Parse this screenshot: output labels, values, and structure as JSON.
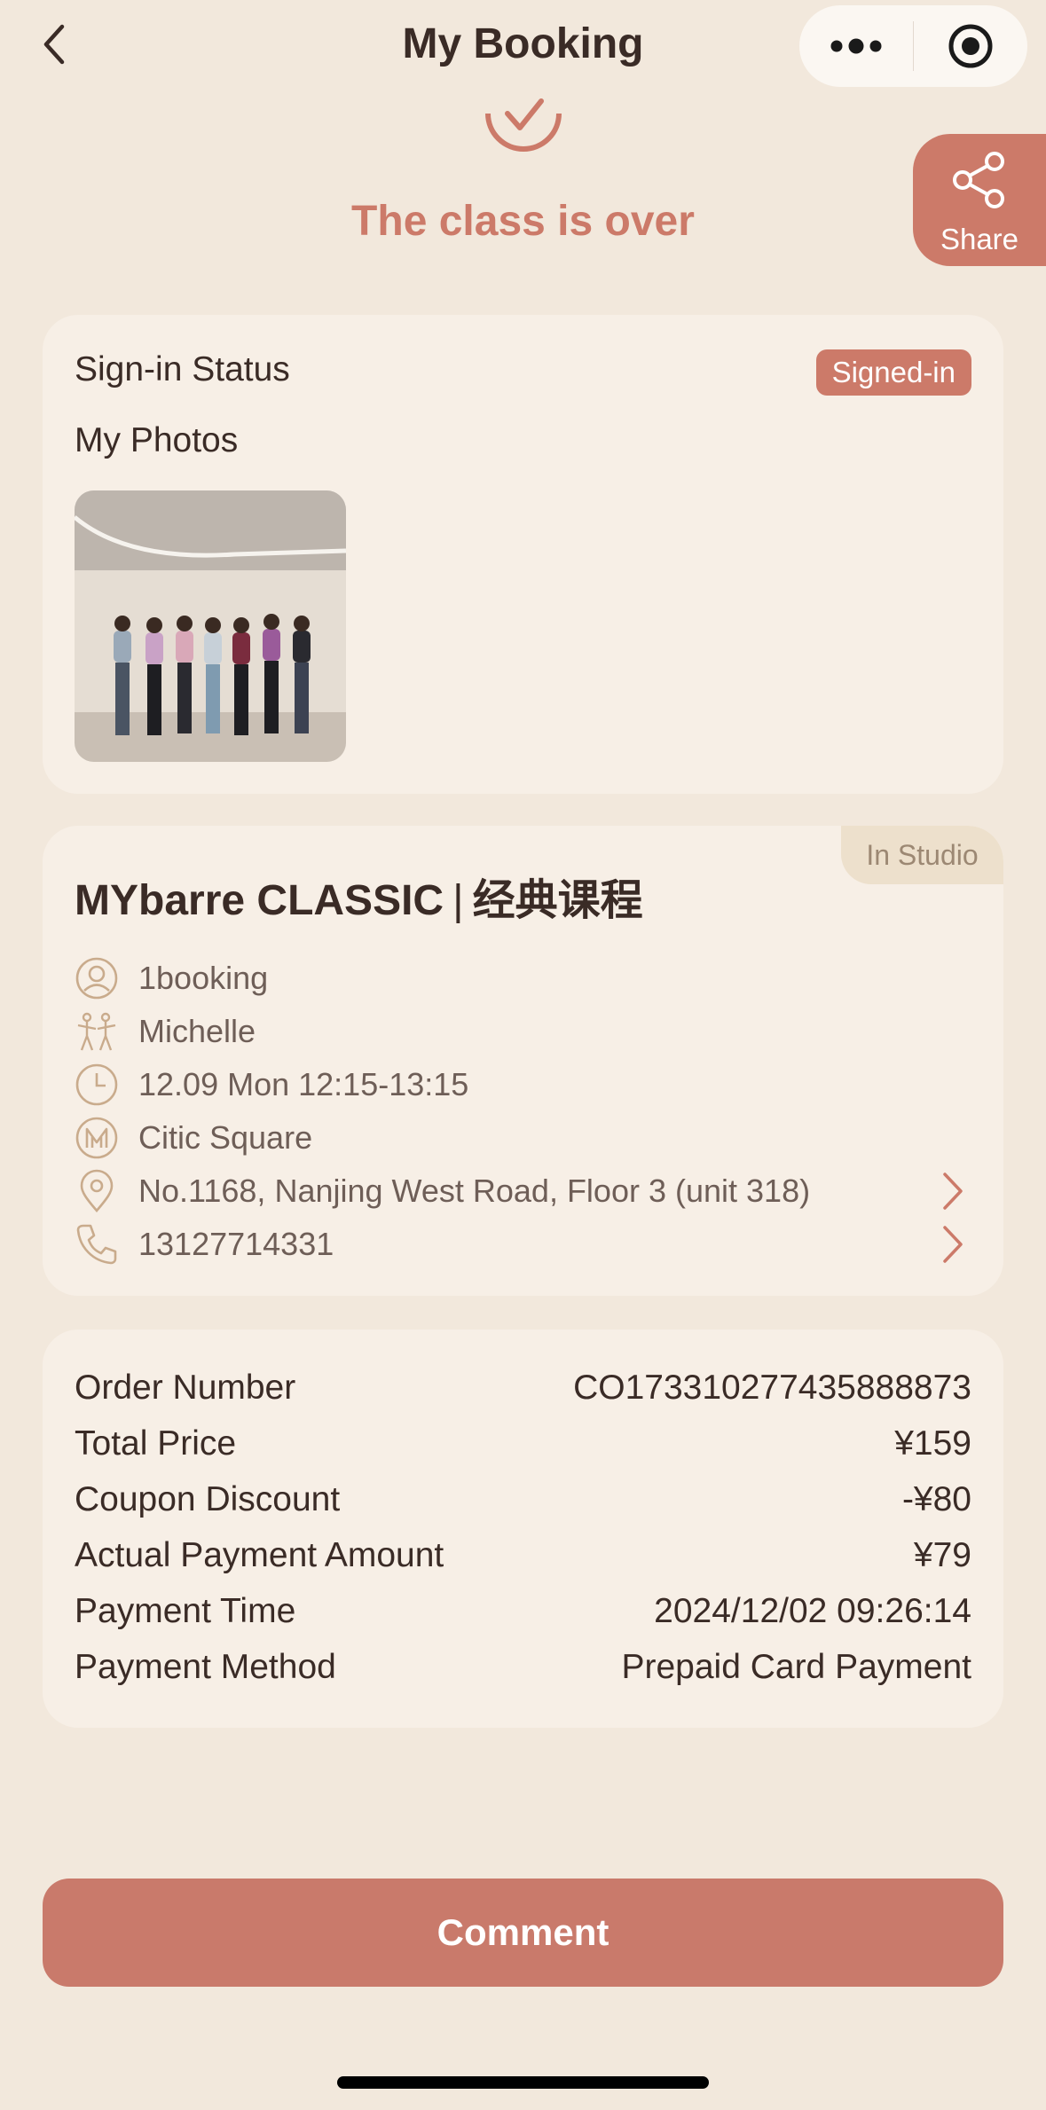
{
  "nav": {
    "title": "My Booking"
  },
  "status": {
    "text": "The class is over"
  },
  "share": {
    "label": "Share"
  },
  "signin": {
    "label": "Sign-in Status",
    "badge": "Signed-in",
    "photos_label": "My Photos"
  },
  "class_info": {
    "tag": "In Studio",
    "title_en": "MYbarre CLASSIC",
    "title_cn": "经典课程",
    "rows": [
      {
        "icon": "user-icon",
        "text": "1booking"
      },
      {
        "icon": "instructor-icon",
        "text": "Michelle"
      },
      {
        "icon": "clock-icon",
        "text": "12.09 Mon 12:15-13:15"
      },
      {
        "icon": "studio-logo-icon",
        "text": "Citic Square"
      },
      {
        "icon": "location-pin-icon",
        "text": "No.1168, Nanjing West Road, Floor 3 (unit 318)"
      },
      {
        "icon": "phone-icon",
        "text": "13127714331"
      }
    ]
  },
  "order": {
    "rows": [
      {
        "label": "Order Number",
        "value": "CO17331027743588887​3"
      },
      {
        "label": "Total Price",
        "value": "¥159"
      },
      {
        "label": "Coupon Discount",
        "value": "-¥80"
      },
      {
        "label": "Actual Payment Amount",
        "value": "¥79"
      },
      {
        "label": "Payment Time",
        "value": "2024/12/02 09:26:14"
      },
      {
        "label": "Payment Method",
        "value": "Prepaid Card Payment"
      }
    ]
  },
  "actions": {
    "comment_label": "Comment"
  },
  "colors": {
    "background": "#f2e8dc",
    "card": "#f7efe6",
    "accent": "#cc7a69",
    "text": "#3a2b26",
    "muted": "#6e5e57"
  }
}
